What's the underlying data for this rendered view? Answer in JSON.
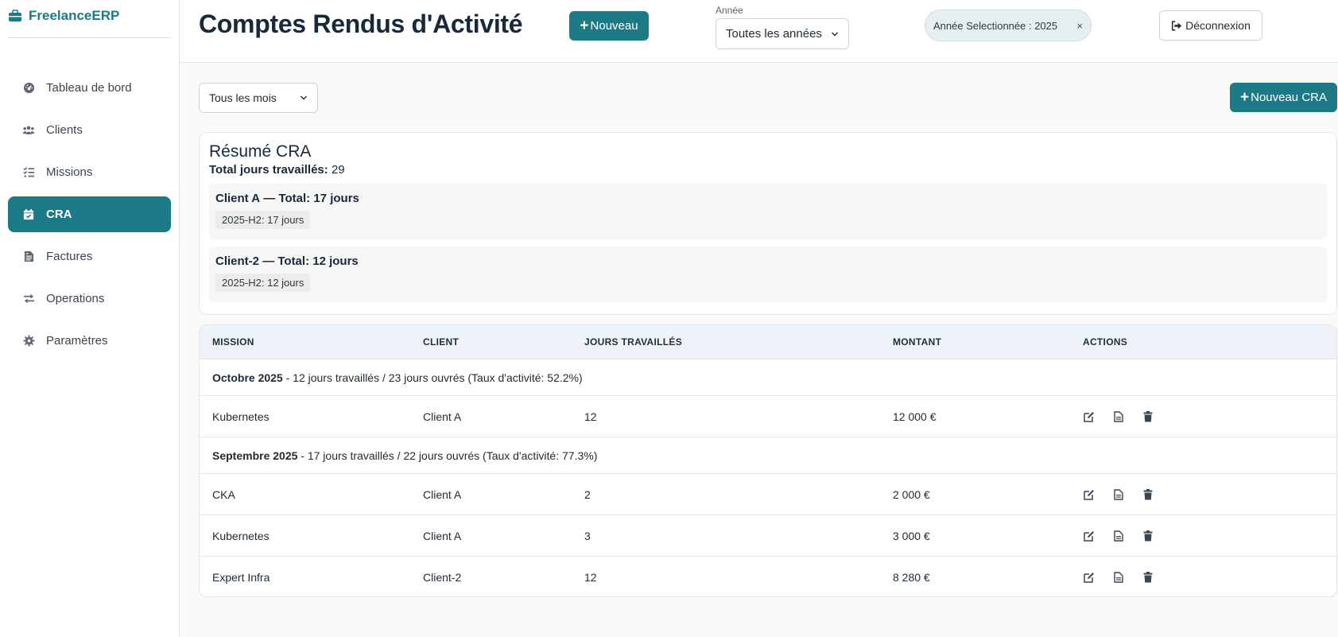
{
  "brand": {
    "name": "FreelanceERP",
    "icon": "briefcase-icon"
  },
  "sidebar": {
    "items": [
      {
        "label": "Tableau de bord",
        "icon": "dashboard-icon",
        "active": false
      },
      {
        "label": "Clients",
        "icon": "users-icon",
        "active": false
      },
      {
        "label": "Missions",
        "icon": "tasks-icon",
        "active": false
      },
      {
        "label": "CRA",
        "icon": "calendar-check-icon",
        "active": true
      },
      {
        "label": "Factures",
        "icon": "invoice-icon",
        "active": false
      },
      {
        "label": "Operations",
        "icon": "transfer-icon",
        "active": false
      },
      {
        "label": "Paramètres",
        "icon": "gear-icon",
        "active": false
      }
    ]
  },
  "header": {
    "title": "Comptes Rendus d'Activité",
    "new_button": "Nouveau",
    "year_label": "Année",
    "year_select_value": "Toutes les années",
    "selected_year_chip": "Année Selectionnée : 2025",
    "chip_close": "×",
    "logout_button": "Déconnexion"
  },
  "filters": {
    "month_select_value": "Tous les mois",
    "new_cra_button": "Nouveau CRA"
  },
  "summary": {
    "title": "Résumé CRA",
    "total_label": "Total jours travaillés:",
    "total_value": "29",
    "clients": [
      {
        "name": "Client A",
        "total_text": "— Total: 17 jours",
        "period": "2025-H2: 17 jours"
      },
      {
        "name": "Client-2",
        "total_text": "— Total: 12 jours",
        "period": "2025-H2: 12 jours"
      }
    ]
  },
  "table": {
    "headers": {
      "mission": "MISSION",
      "client": "CLIENT",
      "jours": "JOURS TRAVAILLÉS",
      "montant": "MONTANT",
      "actions": "ACTIONS"
    },
    "groups": [
      {
        "month": "Octobre 2025",
        "detail": " - 12 jours travaillés / 23 jours ouvrés (Taux d'activité: 52.2%)",
        "rows": [
          {
            "mission": "Kubernetes",
            "client": "Client A",
            "jours": "12",
            "montant": "12 000 €"
          }
        ]
      },
      {
        "month": "Septembre 2025",
        "detail": " - 17 jours travaillés / 22 jours ouvrés (Taux d'activité: 77.3%)",
        "rows": [
          {
            "mission": "CKA",
            "client": "Client A",
            "jours": "2",
            "montant": "2 000 €"
          },
          {
            "mission": "Kubernetes",
            "client": "Client A",
            "jours": "3",
            "montant": "3 000 €"
          },
          {
            "mission": "Expert Infra",
            "client": "Client-2",
            "jours": "12",
            "montant": "8 280 €"
          }
        ]
      }
    ]
  },
  "colors": {
    "accent": "#1c7a86",
    "text_dark": "#17293a",
    "table_header_bg": "#eef3fa"
  }
}
